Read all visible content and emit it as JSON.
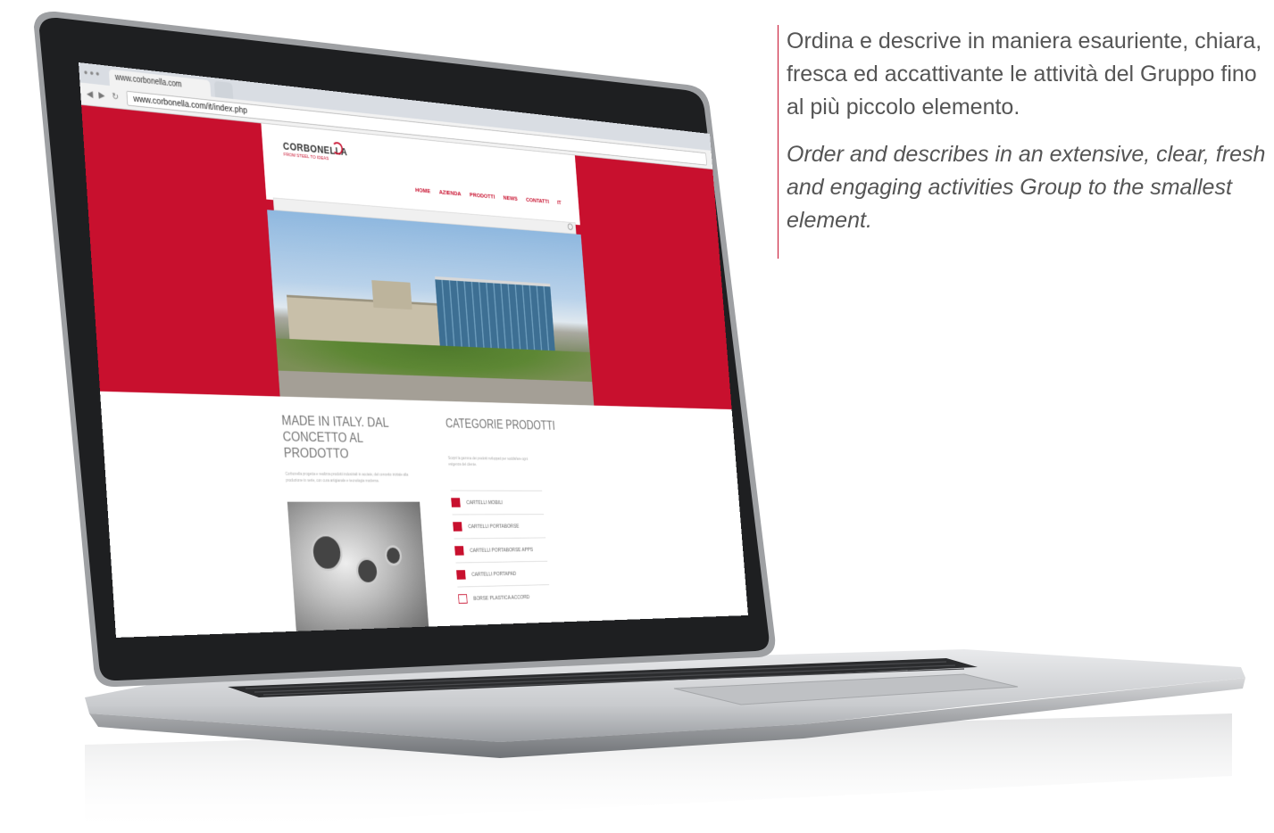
{
  "caption": {
    "it": "Ordina e descrive in maniera esauriente, chiara, fresca ed accattivante le attività del Gruppo fino al più piccolo elemento.",
    "en": "Order and describes in an extensive, clear, fresh and engaging activities Group to the smallest element."
  },
  "browser": {
    "tab_title": "www.corbonella.com",
    "url": "www.corbonella.com/it/index.php",
    "window_controls": "● ● ●",
    "back": "◀",
    "forward": "▶",
    "reload": "↻"
  },
  "site": {
    "logo": "CORBONELLA",
    "logo_sub": "FROM STEEL TO IDEAS",
    "nav": [
      "HOME",
      "AZIENDA",
      "PRODOTTI",
      "NEWS",
      "CONTATTI",
      "IT"
    ],
    "intro": {
      "title": "MADE IN ITALY. DAL CONCETTO AL PRODOTTO",
      "text": "Corbonella progetta e realizza prodotti industriali in acciaio, dal concetto iniziale alla produzione in serie, con cura artigianale e tecnologia moderna."
    },
    "categories": {
      "title": "CATEGORIE PRODOTTI",
      "text": "Scopri la gamma dei prodotti sviluppati per soddisfare ogni esigenza del cliente.",
      "items": [
        {
          "label": "CARTELLI MOBILI",
          "icon": "catalog-icon"
        },
        {
          "label": "CARTELLI PORTABORSE",
          "icon": "folder-icon"
        },
        {
          "label": "CARTELLI PORTABORSE APPS",
          "icon": "tag-icon"
        },
        {
          "label": "CARTELLI PORTAPAD",
          "icon": "card-icon"
        },
        {
          "label": "BORSE PLASTICA ACCORD",
          "icon": "bag-icon"
        }
      ]
    }
  },
  "colors": {
    "brand_red": "#c8102e",
    "caption_text": "#555555"
  }
}
